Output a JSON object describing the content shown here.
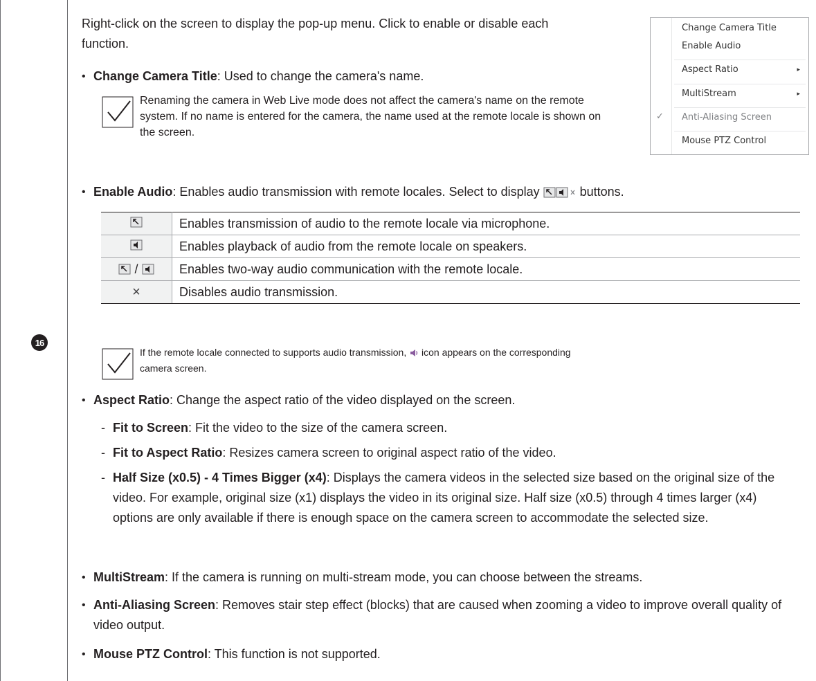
{
  "row_number": "16",
  "intro": "Right-click on the screen to display the pop-up menu. Click to enable or disable each function.",
  "change_title": {
    "term": "Change Camera Title",
    "desc": ": Used to change the camera's name.",
    "note": "Renaming the camera in Web Live mode does not affect the camera's name on the remote system. If no name is entered for the camera, the name used at the remote locale is shown on the screen."
  },
  "popup_menu": {
    "items": [
      {
        "label": "Change Camera Title"
      },
      {
        "label": "Enable Audio"
      },
      {
        "label": "Aspect Ratio",
        "arrow": "▸"
      },
      {
        "label": "MultiStream",
        "arrow": "▸"
      },
      {
        "label": "Anti-Aliasing Screen",
        "check": "✓"
      },
      {
        "label": "Mouse PTZ Control"
      }
    ]
  },
  "enable_audio": {
    "term": "Enable Audio",
    "desc_before": ": Enables audio transmission with remote locales. Select to display",
    "desc_after": "buttons.",
    "table": [
      {
        "icon": "microphone-icon",
        "desc": "Enables transmission of audio to the remote locale via microphone."
      },
      {
        "icon": "speaker-icon",
        "desc": "Enables playback of audio from the remote locale on speakers."
      },
      {
        "icon": "microphone-speaker-icon",
        "separator": "/",
        "desc": "Enables two-way audio communication with the remote locale."
      },
      {
        "icon": "close-icon",
        "symbol": "×",
        "desc": "Disables audio transmission."
      }
    ],
    "note_before": "If the remote locale connected to supports audio transmission,",
    "note_after": "icon appears on the corresponding camera screen."
  },
  "aspect_ratio": {
    "term": "Aspect Ratio",
    "desc": ": Change the aspect ratio of the video displayed on the screen.",
    "subs": [
      {
        "term": "Fit to Screen",
        "desc": ": Fit the video to the size of the camera screen."
      },
      {
        "term": "Fit to Aspect Ratio",
        "desc": ": Resizes camera screen to original aspect ratio of the video."
      },
      {
        "term": "Half Size (x0.5) - 4 Times Bigger (x4)",
        "desc": ": Displays the camera videos in the selected size based on the original size of the video. For example, original size (x1) displays the video in its original size. Half size (x0.5) through 4 times larger (x4) options are only available if there is enough space on the camera screen to accommodate the selected size."
      }
    ]
  },
  "multistream": {
    "term": "MultiStream",
    "desc": ": If the camera is running on multi-stream mode, you can choose between the streams."
  },
  "anti_aliasing": {
    "term": "Anti-Aliasing Screen",
    "desc": ": Removes stair step effect (blocks) that are caused when zooming a video to improve overall quality of video output."
  },
  "mouse_ptz": {
    "term": "Mouse PTZ Control",
    "desc": ": This function is not supported."
  },
  "bullet_char": "•",
  "dash_char": "-",
  "colors": {
    "text": "#231f20",
    "rule": "#6d6e71",
    "table_icon_bg": "#f1f2f2",
    "audio_icon": "#8a5c9e"
  }
}
